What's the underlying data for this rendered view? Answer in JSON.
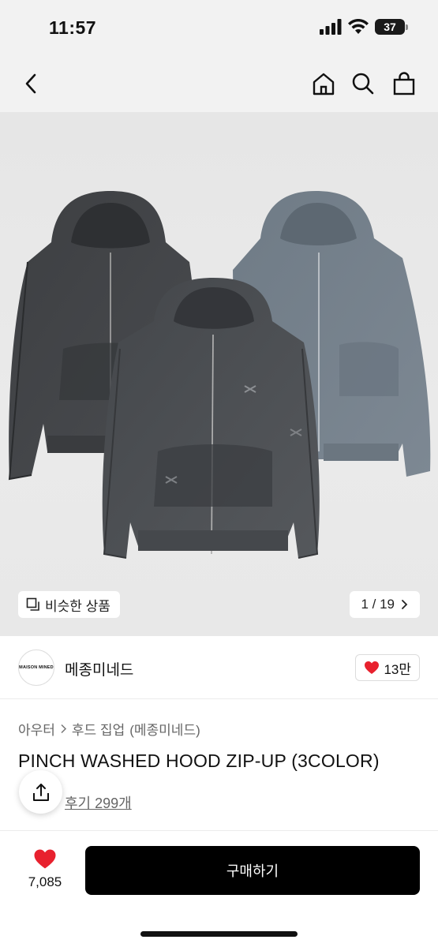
{
  "status": {
    "time": "11:57",
    "battery": "37"
  },
  "icons": {
    "back": "chevron-left-icon",
    "home": "home-icon",
    "search": "search-icon",
    "bag": "shopping-bag-icon",
    "share": "share-icon",
    "heart": "heart-icon"
  },
  "colors": {
    "accent": "#e8212e",
    "buy_button": "#000000",
    "image_bg": "#e8e8e8"
  },
  "gallery": {
    "similar_label": "비슷한 상품",
    "page_indicator": "1 / 19"
  },
  "brand": {
    "logo_text": "MAISON MINED",
    "name": "메종미네드",
    "likes": "13만"
  },
  "product": {
    "breadcrumb": [
      "아우터",
      "후드 집업",
      "(메종미네드)"
    ],
    "title": "PINCH WASHED HOOD ZIP-UP (3COLOR)",
    "review_link": "후기 299개"
  },
  "bottom_bar": {
    "wish_count": "7,085",
    "buy_label": "구매하기"
  }
}
